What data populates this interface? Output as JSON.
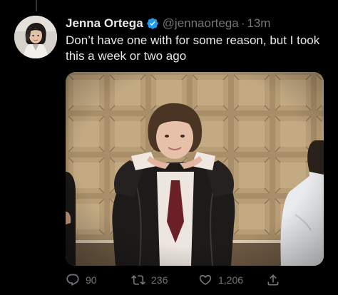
{
  "tweet": {
    "author": {
      "display_name": "Jenna Ortega",
      "verified": true,
      "handle": "@jennaortega",
      "separator": "·",
      "time": "13m",
      "avatar_icon": "profile-photo"
    },
    "text": "Don’t have one with for some reason, but I took this a week or two ago",
    "media": {
      "type": "photo"
    },
    "actions": {
      "replies": "90",
      "retweets": "236",
      "likes": "1,206"
    }
  },
  "colors": {
    "background": "#000000",
    "primary_text": "#e7e9ea",
    "secondary_text": "#71767b",
    "verified_badge": "#1d9bf0"
  }
}
